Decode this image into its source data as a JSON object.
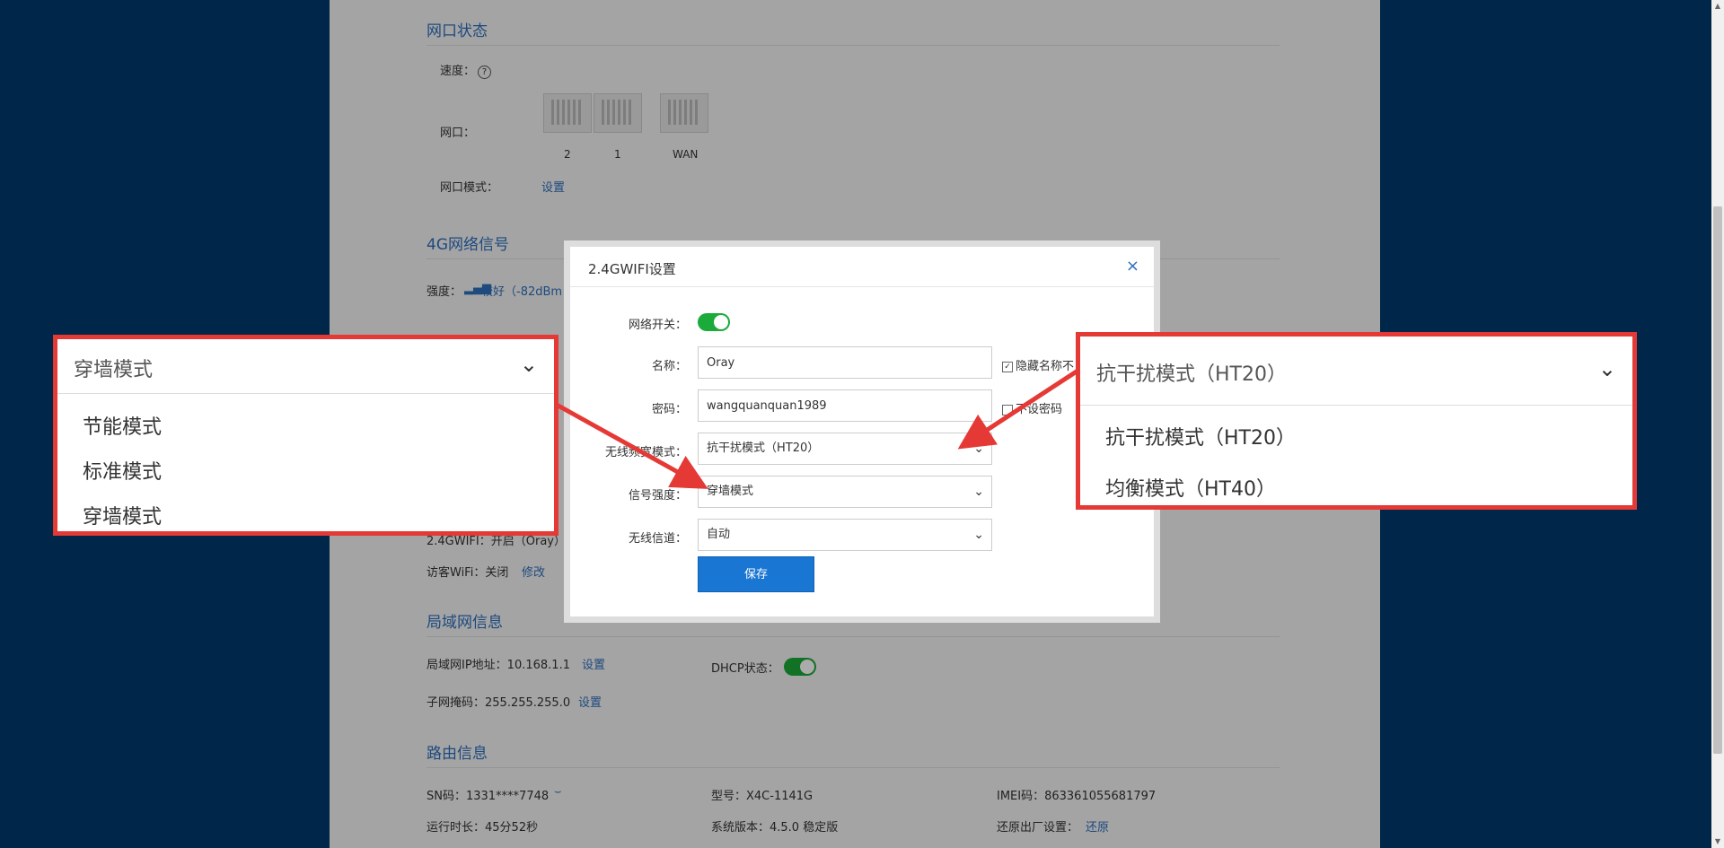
{
  "port_status": {
    "title": "网口状态",
    "speed_label": "速度：",
    "speed_help": "?",
    "ports_label": "网口：",
    "ports": [
      "2",
      "1",
      "WAN"
    ],
    "mode_label": "网口模式：",
    "mode_link": "设置"
  },
  "signal_4g": {
    "title": "4G网络信号",
    "strength_label": "强度：",
    "strength_value": "较好（-82dBm"
  },
  "wifi_summary": {
    "wifi24_label": "2.4GWIFI：开启（Oray）",
    "guest_label": "访客WiFi：关闭",
    "guest_link": "修改"
  },
  "lan": {
    "title": "局域网信息",
    "ip_label": "局域网IP地址：10.168.1.1",
    "ip_link": "设置",
    "mask_label": "子网掩码：255.255.255.0",
    "mask_link": "设置",
    "dhcp_label": "DHCP状态："
  },
  "router": {
    "title": "路由信息",
    "sn": "SN码：1331****7748",
    "model": "型号：X4C-1141G",
    "imei": "IMEI码：863361055681797",
    "uptime": "运行时长：45分52秒",
    "version": "系统版本：4.5.0 稳定版",
    "reset_label": "还原出厂设置：",
    "reset_link": "还原"
  },
  "modal": {
    "title": "2.4GWIFI设置",
    "close": "×",
    "switch_label": "网络开关：",
    "name_label": "名称：",
    "name_value": "Oray",
    "hide_name": "隐藏名称不",
    "password_label": "密码：",
    "password_value": "wangquanquan1989",
    "no_password": "不设密码",
    "bandwidth_label": "无线频宽模式：",
    "bandwidth_value": "抗干扰模式（HT20）",
    "signal_label": "信号强度：",
    "signal_value": "穿墙模式",
    "channel_label": "无线信道：",
    "channel_value": "自动",
    "save": "保存"
  },
  "callout_signal": {
    "selected": "穿墙模式",
    "options": [
      "节能模式",
      "标准模式",
      "穿墙模式"
    ]
  },
  "callout_bandwidth": {
    "selected": "抗干扰模式（HT20）",
    "options": [
      "抗干扰模式（HT20）",
      "均衡模式（HT40）"
    ]
  },
  "colors": {
    "accent": "#2e6fbd",
    "toggle_on": "#1aab3a",
    "callout_border": "#e53935",
    "save_button": "#1976d2"
  }
}
